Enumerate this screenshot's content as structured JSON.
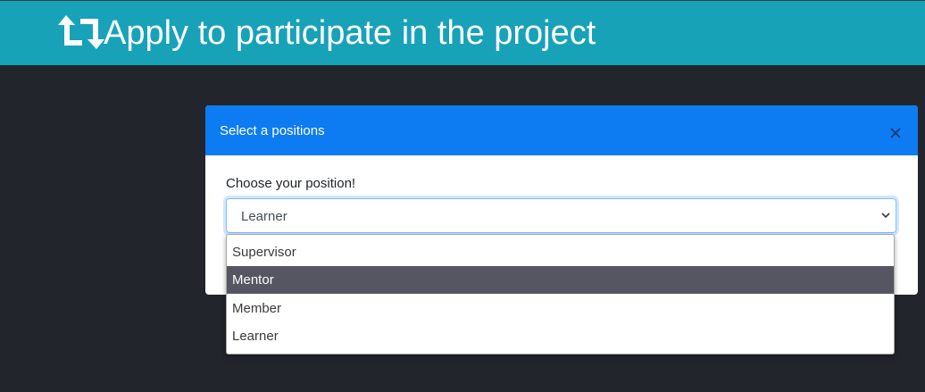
{
  "header": {
    "title": "Apply to participate in the project",
    "icon": "retweet-icon",
    "background": "#17a2b8"
  },
  "modal": {
    "title": "Select a positions",
    "close_icon": "close-icon",
    "header_color": "#0d7cf2",
    "label": "Choose your position!",
    "select": {
      "selected_value": "Learner",
      "chevron_icon": "chevron-down-icon"
    }
  },
  "dropdown": {
    "options": [
      {
        "label": "Supervisor",
        "highlighted": false
      },
      {
        "label": "Mentor",
        "highlighted": true
      },
      {
        "label": "Member",
        "highlighted": false
      },
      {
        "label": "Learner",
        "highlighted": false
      }
    ],
    "highlight_color": "#565562"
  }
}
